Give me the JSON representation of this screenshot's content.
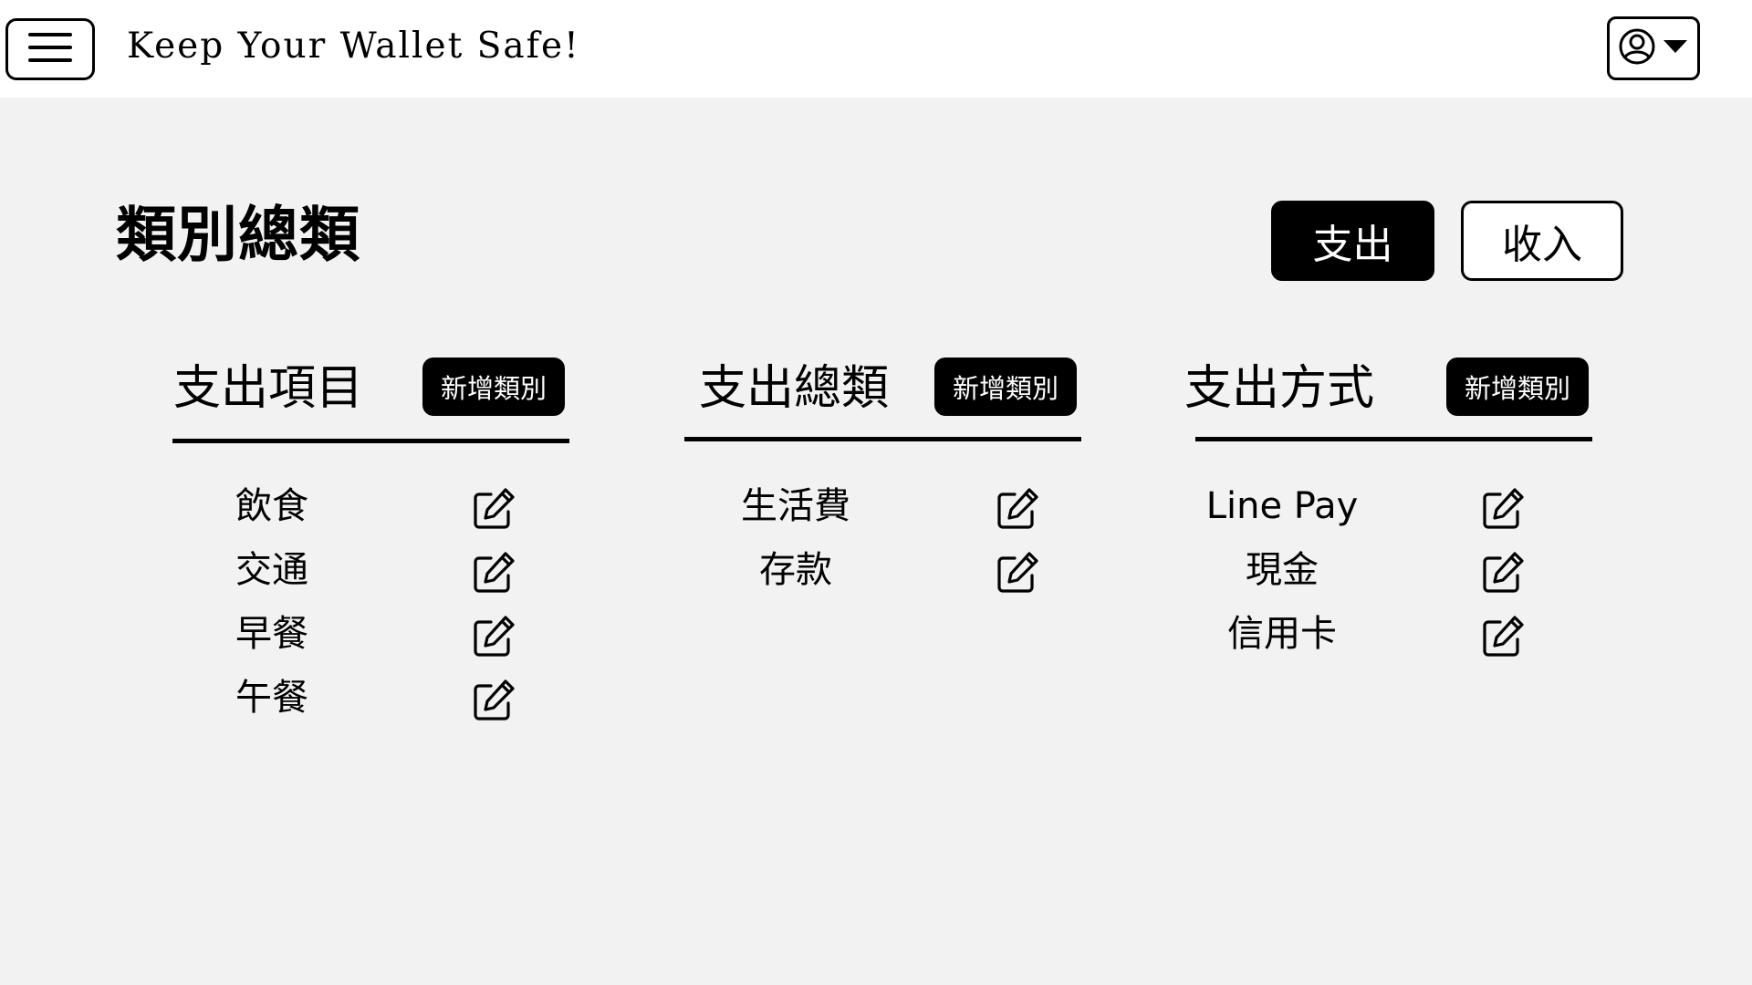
{
  "header": {
    "menu_icon": "hamburger-menu-icon",
    "title": "Keep Your Wallet Safe!",
    "user_icon": "user-circle-icon",
    "dropdown_icon": "caret-down-icon"
  },
  "main": {
    "page_title": "類別總類",
    "type_toggle": {
      "expense_label": "支出",
      "income_label": "收入",
      "selected": "支出"
    },
    "columns": [
      {
        "title": "支出項目",
        "add_label": "新增類別",
        "items": [
          {
            "label": "飲食"
          },
          {
            "label": "交通"
          },
          {
            "label": "早餐"
          },
          {
            "label": "午餐"
          }
        ]
      },
      {
        "title": "支出總類",
        "add_label": "新增類別",
        "items": [
          {
            "label": "生活費"
          },
          {
            "label": "存款"
          }
        ]
      },
      {
        "title": "支出方式",
        "add_label": "新增類別",
        "items": [
          {
            "label": "Line Pay"
          },
          {
            "label": "現金"
          },
          {
            "label": "信用卡"
          }
        ]
      }
    ],
    "edit_icon": "edit-icon"
  },
  "colors": {
    "header_bg": "#ffffff",
    "main_bg": "#f2f2f2",
    "accent": "#000000",
    "accent_text": "#ffffff"
  }
}
